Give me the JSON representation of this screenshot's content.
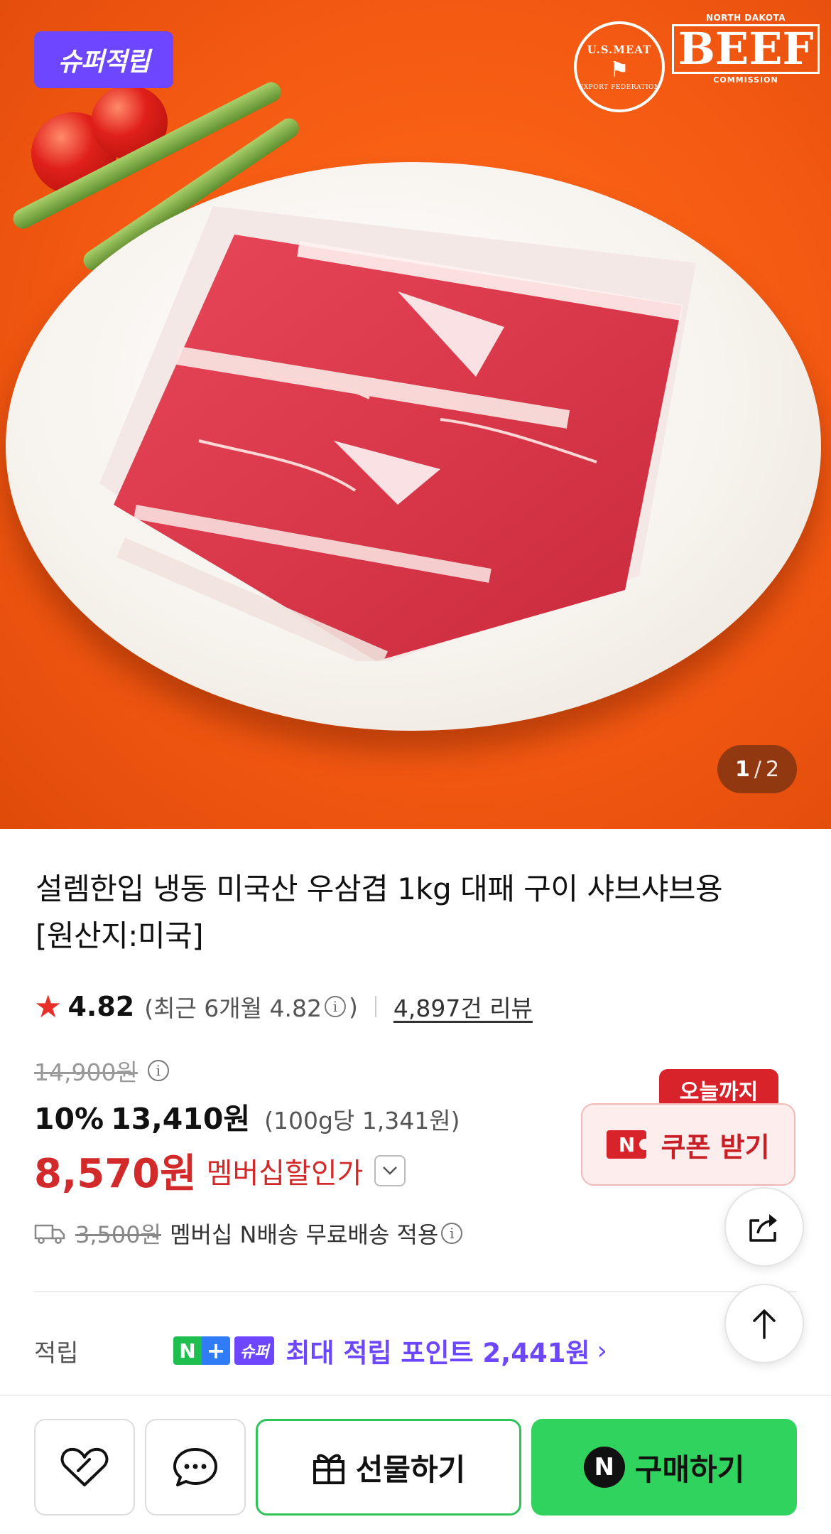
{
  "hero": {
    "badge": "슈퍼적립",
    "logos": {
      "usmef": {
        "top": "U.S.MEAT",
        "bottom": "EXPORT FEDERATION"
      },
      "ndbc": {
        "top": "NORTH DAKOTA",
        "main": "BEEF",
        "bottom": "COMMISSION"
      }
    },
    "counter": {
      "current": "1",
      "separator": "/",
      "total": "2"
    }
  },
  "product": {
    "title_line1": "설렘한입 냉동 미국산 우삼겹 1kg 대패 구이 샤브샤브용",
    "title_line2": "[원산지:미국]",
    "rating": {
      "score": "4.82",
      "recent_open": "(최근 6개월 4.82",
      "recent_close": ")",
      "review_count": "4,897건 리뷰"
    },
    "price": {
      "original": "14,900원",
      "discount_rate": "10%",
      "sale": "13,410원",
      "unit": "(100g당 1,341원)",
      "member_price": "8,570원",
      "member_label": "멤버십할인가"
    },
    "coupon": {
      "tag": "오늘까지",
      "n": "N",
      "label": "쿠폰 받기"
    },
    "shipping": {
      "fee": "3,500원",
      "text": "멤버십 N배송 무료배송 적용"
    },
    "points": {
      "label": "적립",
      "badge_n": "N",
      "badge_plus": "+",
      "badge_super": "슈퍼",
      "text": "최대 적립 포인트 2,441원",
      "chevron": "›"
    }
  },
  "bottom_bar": {
    "gift_label": "선물하기",
    "buy_label": "구매하기",
    "buy_logo": "N"
  },
  "colors": {
    "accent_purple": "#6c47ff",
    "sale_red": "#d22a2a",
    "naver_green": "#2fd35e",
    "hero_orange": "#f45a12"
  },
  "icons": [
    "truck-icon",
    "share-icon",
    "arrow-up-icon",
    "heart-icon",
    "talk-icon",
    "gift-icon",
    "info-icon",
    "star-icon",
    "chevron-down-icon"
  ]
}
